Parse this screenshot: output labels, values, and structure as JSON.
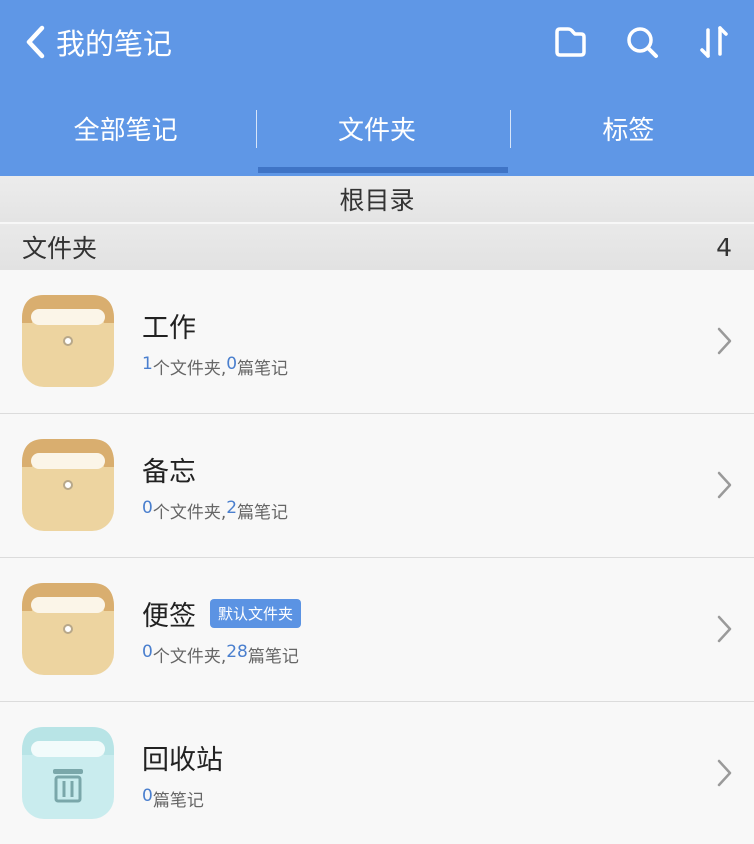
{
  "header": {
    "back_label": "我的笔记",
    "icons": [
      "folder-icon",
      "search-icon",
      "sort-icon"
    ],
    "bg_color": "#5f97e6"
  },
  "tabs": [
    {
      "label": "全部笔记",
      "active": false
    },
    {
      "label": "文件夹",
      "active": true
    },
    {
      "label": "标签",
      "active": false
    }
  ],
  "breadcrumb": "根目录",
  "section": {
    "title": "文件夹",
    "count": "4"
  },
  "folders": [
    {
      "name": "工作",
      "badge": "",
      "folders_count": "1",
      "folders_unit": " 个文件夹, ",
      "notes_count": "0",
      "notes_unit": " 篇笔记",
      "icon": "folder-icon"
    },
    {
      "name": "备忘",
      "badge": "",
      "folders_count": "0",
      "folders_unit": " 个文件夹, ",
      "notes_count": "2",
      "notes_unit": " 篇笔记",
      "icon": "folder-icon"
    },
    {
      "name": "便签",
      "badge": "默认文件夹",
      "folders_count": "0",
      "folders_unit": " 个文件夹, ",
      "notes_count": "28",
      "notes_unit": " 篇笔记",
      "icon": "folder-icon"
    },
    {
      "name": "回收站",
      "badge": "",
      "folders_count": "",
      "folders_unit": "",
      "notes_count": "0",
      "notes_unit": " 篇笔记",
      "icon": "trash-icon"
    }
  ]
}
